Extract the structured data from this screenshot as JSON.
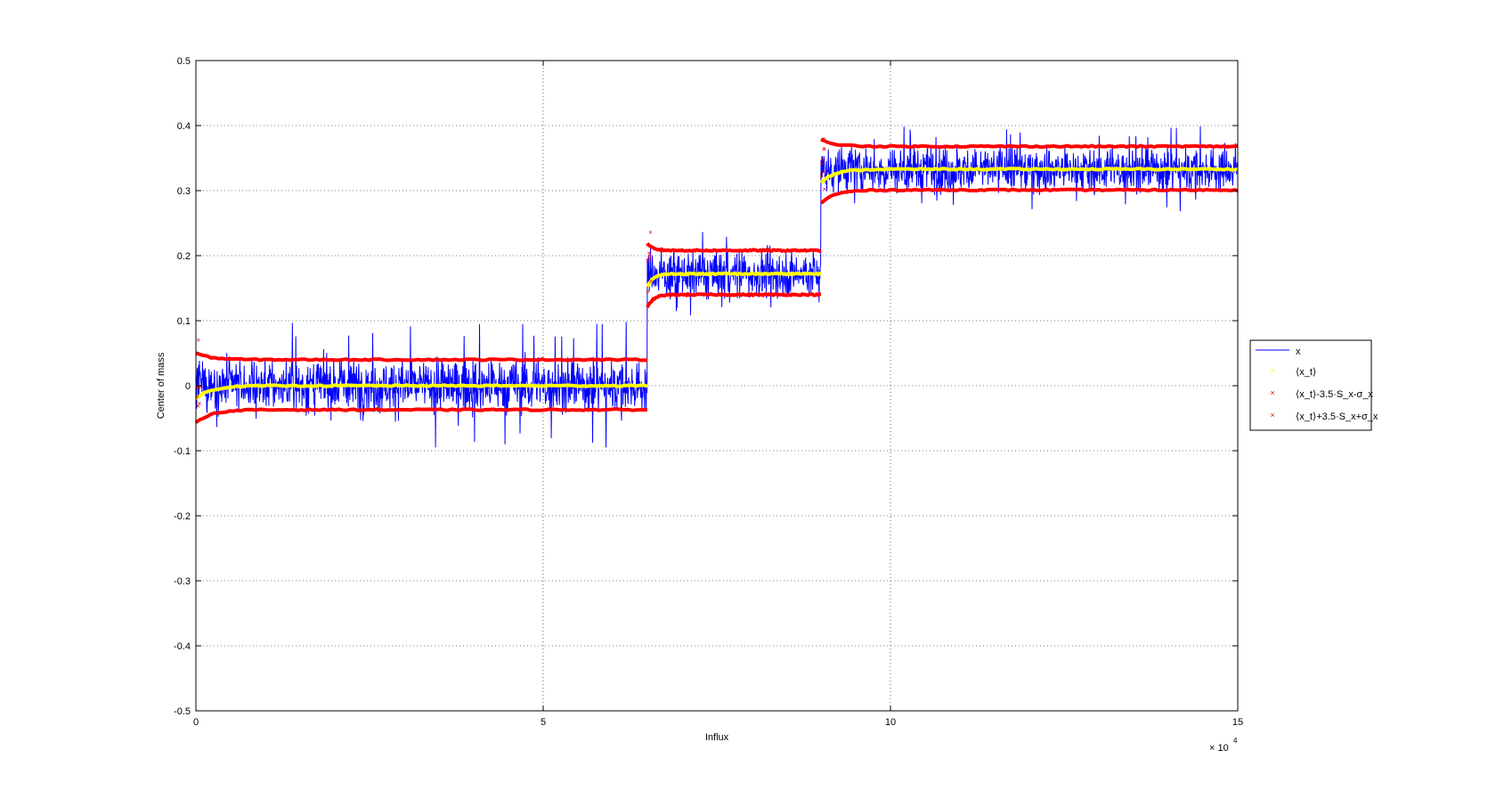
{
  "chart_data": {
    "type": "line",
    "title": "",
    "xlabel": "Influx",
    "ylabel": "Center of mass",
    "x_exponent_label": "× 10",
    "x_exponent_power": "4",
    "xlim": [
      0,
      15
    ],
    "ylim": [
      -0.5,
      0.5
    ],
    "xticks": [
      0,
      5,
      10,
      15
    ],
    "yticks": [
      -0.5,
      -0.4,
      -0.3,
      -0.2,
      -0.1,
      0,
      0.1,
      0.2,
      0.3,
      0.4,
      0.5
    ],
    "xtick_labels": [
      "0",
      "5",
      "10",
      "15"
    ],
    "ytick_labels": [
      "-0.5",
      "-0.4",
      "-0.3",
      "-0.2",
      "-0.1",
      "0",
      "0.1",
      "0.2",
      "0.3",
      "0.4",
      "0.5"
    ],
    "grid": true,
    "legend_position": "outside-right",
    "segments": [
      {
        "x_start": 0,
        "x_end": 6.5,
        "mean": 0.0,
        "lower": -0.037,
        "upper": 0.04,
        "noise_min": -0.095,
        "noise_max": 0.1
      },
      {
        "x_start": 6.5,
        "x_end": 9.0,
        "mean": 0.172,
        "lower": 0.14,
        "upper": 0.208,
        "noise_min": 0.1,
        "noise_max": 0.24
      },
      {
        "x_start": 9.0,
        "x_end": 15,
        "mean": 0.333,
        "lower": 0.301,
        "upper": 0.368,
        "noise_min": 0.262,
        "noise_max": 0.4
      }
    ],
    "series": [
      {
        "name": "x",
        "color": "#0000ff",
        "style": "line"
      },
      {
        "name": "⟨x_t⟩",
        "color": "#ffff00",
        "style": "marker-x"
      },
      {
        "name": "⟨x_t⟩-3.5·S_x-σ_x",
        "color": "#ff0000",
        "style": "marker-x"
      },
      {
        "name": "⟨x_t⟩+3.5·S_x+σ_x",
        "color": "#ff0000",
        "style": "marker-x"
      }
    ]
  }
}
